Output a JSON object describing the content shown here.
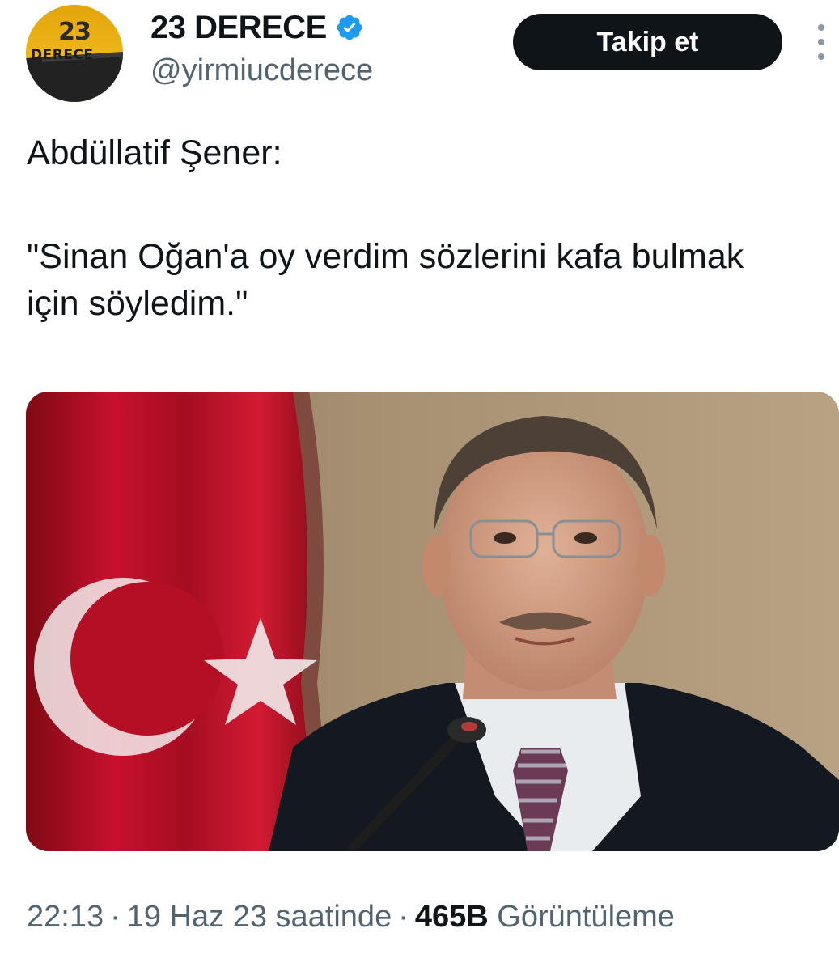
{
  "account": {
    "display_name": "23 DERECE",
    "handle": "@yirmiucderece",
    "avatar_logo_number": "23",
    "avatar_logo_word": "DERECE",
    "verified_icon": "verified-badge-icon",
    "verified_color": "#1d9bf0"
  },
  "actions": {
    "follow_label": "Takip et",
    "more_icon": "more-vertical-icon"
  },
  "tweet": {
    "line1": "Abdüllatif Şener:",
    "line2": "\"Sinan Oğan'a oy verdim sözlerini kafa bulmak için söyledim.\""
  },
  "meta": {
    "time": "22:13",
    "separator": "·",
    "date": "19 Haz 23 saatinde",
    "views_count": "465B",
    "views_label": "Görüntüleme"
  },
  "colors": {
    "text_primary": "#0f1419",
    "text_secondary": "#536471",
    "button_bg": "#0f1419",
    "flag_red": "#c8102e",
    "brand_yellow": "#f2c022"
  }
}
